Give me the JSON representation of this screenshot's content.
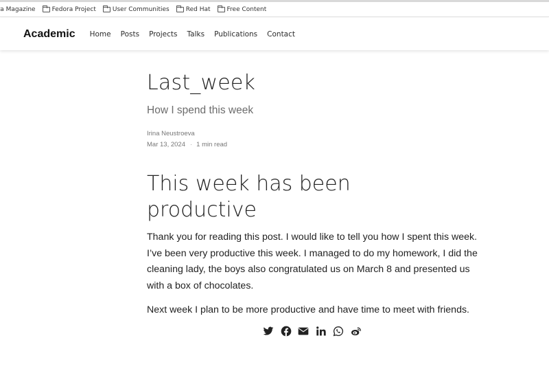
{
  "bookmarks": [
    {
      "label": "ora Magazine",
      "icon": "none"
    },
    {
      "label": "Fedora Project",
      "icon": "folder-icon"
    },
    {
      "label": "User Communities",
      "icon": "folder-icon"
    },
    {
      "label": "Red Hat",
      "icon": "folder-icon"
    },
    {
      "label": "Free Content",
      "icon": "folder-icon"
    }
  ],
  "navbar": {
    "brand": "Academic",
    "links": [
      "Home",
      "Posts",
      "Projects",
      "Talks",
      "Publications",
      "Contact"
    ]
  },
  "article": {
    "title": "Last_week",
    "subtitle": "How I spend this week",
    "author": "Irina Neustroeva",
    "date": "Mar 13, 2024",
    "separator": "·",
    "read_time": "1 min read",
    "heading": "This week has been productive",
    "paragraph1": "Thank you for reading this post. I would like to tell you how I spent this week. I’ve been very productive this week. I managed to do my homework, I did the cleaning lady, the boys also congratulated us on March 8 and presented us with a box of chocolates.",
    "paragraph2": "Next week I plan to be more productive and have time to meet with friends."
  },
  "share": {
    "icons": [
      "twitter-icon",
      "facebook-icon",
      "email-icon",
      "linkedin-icon",
      "whatsapp-icon",
      "weibo-icon"
    ]
  },
  "colors": {
    "text": "#222222",
    "muted": "#777777",
    "subtitle": "#6c6c6c"
  }
}
